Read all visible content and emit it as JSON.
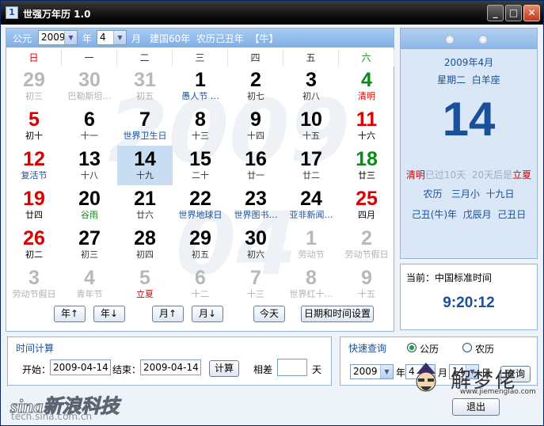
{
  "window": {
    "title": "世强万年历 1.0",
    "app_icon": "1",
    "minimize_icon": "minimize-icon",
    "maximize_icon": "maximize-icon",
    "close_icon": "close-icon"
  },
  "header": {
    "gongli_label": "公元",
    "year_value": "2009",
    "year_label": "年",
    "month_value": "4",
    "month_label": "月",
    "info_text": "建国60年  农历己丑年  【牛】"
  },
  "weekdays": [
    "日",
    "一",
    "二",
    "三",
    "四",
    "五",
    "六"
  ],
  "watermark": {
    "year": "2009",
    "month": "04"
  },
  "calendar": {
    "rows": [
      [
        {
          "day": "29",
          "sub": "初三",
          "style": "gray"
        },
        {
          "day": "30",
          "sub": "巴勒斯坦…",
          "style": "gray"
        },
        {
          "day": "31",
          "sub": "初五",
          "style": "gray"
        },
        {
          "day": "1",
          "sub": "愚人节 …",
          "style": "norm",
          "subColor": "blue"
        },
        {
          "day": "2",
          "sub": "初七",
          "style": "norm"
        },
        {
          "day": "3",
          "sub": "初八",
          "style": "norm"
        },
        {
          "day": "4",
          "sub": "清明",
          "style": "green",
          "subColor": "red"
        }
      ],
      [
        {
          "day": "5",
          "sub": "初十",
          "style": "red"
        },
        {
          "day": "6",
          "sub": "十一",
          "style": "norm"
        },
        {
          "day": "7",
          "sub": "世界卫生日",
          "style": "norm",
          "subColor": "blue"
        },
        {
          "day": "8",
          "sub": "十三",
          "style": "norm"
        },
        {
          "day": "9",
          "sub": "十四",
          "style": "norm"
        },
        {
          "day": "10",
          "sub": "十五",
          "style": "norm"
        },
        {
          "day": "11",
          "sub": "十六",
          "style": "red"
        }
      ],
      [
        {
          "day": "12",
          "sub": "复活节",
          "style": "red",
          "subColor": "blue"
        },
        {
          "day": "13",
          "sub": "十八",
          "style": "norm"
        },
        {
          "day": "14",
          "sub": "十九",
          "style": "norm",
          "selected": true
        },
        {
          "day": "15",
          "sub": "二十",
          "style": "norm"
        },
        {
          "day": "16",
          "sub": "廿一",
          "style": "norm"
        },
        {
          "day": "17",
          "sub": "廿二",
          "style": "norm"
        },
        {
          "day": "18",
          "sub": "廿三",
          "style": "green"
        }
      ],
      [
        {
          "day": "19",
          "sub": "廿四",
          "style": "red"
        },
        {
          "day": "20",
          "sub": "谷雨",
          "style": "norm",
          "subColor": "green"
        },
        {
          "day": "21",
          "sub": "廿六",
          "style": "norm"
        },
        {
          "day": "22",
          "sub": "世界地球日",
          "style": "norm",
          "subColor": "blue"
        },
        {
          "day": "23",
          "sub": "世界图书…",
          "style": "norm",
          "subColor": "blue"
        },
        {
          "day": "24",
          "sub": "亚非新闻…",
          "style": "norm",
          "subColor": "blue"
        },
        {
          "day": "25",
          "sub": "四月",
          "style": "red"
        }
      ],
      [
        {
          "day": "26",
          "sub": "初二",
          "style": "red"
        },
        {
          "day": "27",
          "sub": "初三",
          "style": "norm"
        },
        {
          "day": "28",
          "sub": "初四",
          "style": "norm"
        },
        {
          "day": "29",
          "sub": "初五",
          "style": "norm"
        },
        {
          "day": "30",
          "sub": "初六",
          "style": "norm"
        },
        {
          "day": "1",
          "sub": "劳动节",
          "style": "gray"
        },
        {
          "day": "2",
          "sub": "劳动节假日",
          "style": "gray"
        }
      ],
      [
        {
          "day": "3",
          "sub": "劳动节假日",
          "style": "gray"
        },
        {
          "day": "4",
          "sub": "青年节",
          "style": "gray"
        },
        {
          "day": "5",
          "sub": "立夏",
          "style": "gray",
          "subColor": "red"
        },
        {
          "day": "6",
          "sub": "十二",
          "style": "gray"
        },
        {
          "day": "7",
          "sub": "十三",
          "style": "gray"
        },
        {
          "day": "8",
          "sub": "世界红十…",
          "style": "gray"
        },
        {
          "day": "9",
          "sub": "十五",
          "style": "gray"
        }
      ]
    ]
  },
  "nav": {
    "year_up": "年↑",
    "year_down": "年↓",
    "month_up": "月↑",
    "month_down": "月↓",
    "today": "今天",
    "settings": "日期和时间设置"
  },
  "detail": {
    "year_month": "2009年4月",
    "weekday_sign": "星期二  白羊座",
    "day": "14",
    "term_prev": "清明",
    "term_text": "已过10天  20天后是",
    "term_next": "立夏",
    "lunar_line1": "农历   三月小  十九日",
    "lunar_line2": "己丑(牛)年  戊辰月  己丑日"
  },
  "clock": {
    "label": "当前：中国标准时间",
    "time": "9:20:12"
  },
  "calc": {
    "title": "时间计算",
    "start_label": "开始：",
    "start_value": "2009-04-14",
    "end_label": "结束：",
    "end_value": "2009-04-14",
    "calc_button": "计算",
    "diff_label": "相差",
    "diff_value": "",
    "day_unit": "天"
  },
  "query": {
    "title": "快速查询",
    "radio_gregorian": "公历",
    "radio_lunar": "农历",
    "year_value": "2009",
    "year_label": "年",
    "month_value": "4",
    "month_label": "月",
    "day_value": "14",
    "day_label": "日",
    "query_button": "查询"
  },
  "exit_button": "退出",
  "brand": {
    "sina_logo": "sina新浪科技",
    "sina_url": "tech.sina.com.cn",
    "site_logo": "解梦佬",
    "site_url": "www.jiemenglao.com"
  },
  "colors": {
    "accent_blue": "#1a4f9a",
    "weekend_red": "#d80000",
    "holiday_green": "#0a8a1a",
    "header_blue": "#7eaee6",
    "selected_cell": "#c8dcf2"
  }
}
